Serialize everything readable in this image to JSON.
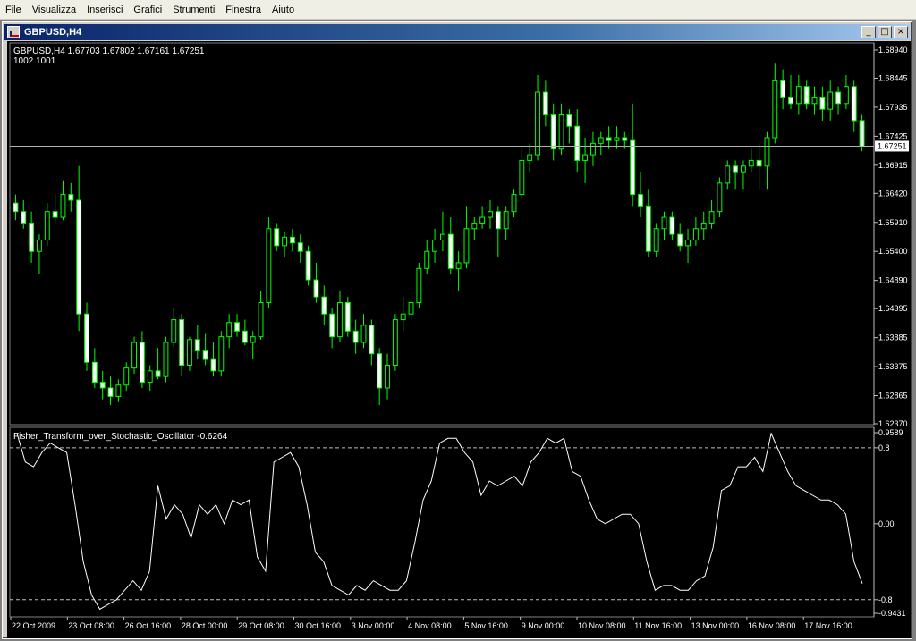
{
  "menu": [
    "File",
    "Visualizza",
    "Inserisci",
    "Grafici",
    "Strumenti",
    "Finestra",
    "Aiuto"
  ],
  "window": {
    "title": "GBPUSD,H4",
    "min_btn": "_",
    "max_btn": "□",
    "close_btn": "×"
  },
  "colors": {
    "background": "#000000",
    "bull": "#ffffff",
    "wick": "#00ff00",
    "indicator": "#ffffff",
    "level": "#c0c0c0"
  },
  "main_chart": {
    "info_line1": "GBPUSD,H4  1.67703 1.67802 1.67161 1.67251",
    "info_line2": "1002  1001",
    "current_price_label": "1.67251",
    "price_ticks": [
      "1.68940",
      "1.68445",
      "1.67935",
      "1.67425",
      "1.66915",
      "1.66420",
      "1.65910",
      "1.65400",
      "1.64890",
      "1.64395",
      "1.63885",
      "1.63375",
      "1.62865",
      "1.62370"
    ]
  },
  "indicator": {
    "label": "Fisher_Transform_over_Stochastic_Oscillator -0.6264",
    "ticks": [
      "0.9589",
      "0.8",
      "0.00",
      "-0.8",
      "-0.9431"
    ]
  },
  "time_axis": [
    "22 Oct 2009",
    "23 Oct 08:00",
    "26 Oct 16:00",
    "28 Oct 00:00",
    "29 Oct 08:00",
    "30 Oct 16:00",
    "3 Nov 00:00",
    "4 Nov 08:00",
    "5 Nov 16:00",
    "9 Nov 00:00",
    "10 Nov 08:00",
    "11 Nov 16:00",
    "13 Nov 00:00",
    "16 Nov 08:00",
    "17 Nov 16:00"
  ],
  "chart_data": {
    "type": "candlestick",
    "symbol": "GBPUSD",
    "timeframe": "H4",
    "ylim": [
      1.6237,
      1.6894
    ],
    "last_price": 1.67251,
    "candles": [
      [
        1.6625,
        1.664,
        1.6595,
        1.661
      ],
      [
        1.661,
        1.663,
        1.658,
        1.659
      ],
      [
        1.659,
        1.661,
        1.652,
        1.654
      ],
      [
        1.654,
        1.657,
        1.65,
        1.656
      ],
      [
        1.656,
        1.6625,
        1.655,
        1.661
      ],
      [
        1.661,
        1.664,
        1.659,
        1.66
      ],
      [
        1.66,
        1.6665,
        1.6595,
        1.664
      ],
      [
        1.664,
        1.666,
        1.661,
        1.663
      ],
      [
        1.663,
        1.669,
        1.64,
        1.643
      ],
      [
        1.643,
        1.645,
        1.633,
        1.6345
      ],
      [
        1.6345,
        1.637,
        1.63,
        1.631
      ],
      [
        1.631,
        1.633,
        1.628,
        1.63
      ],
      [
        1.63,
        1.632,
        1.627,
        1.6285
      ],
      [
        1.6285,
        1.6315,
        1.6275,
        1.6305
      ],
      [
        1.6305,
        1.6345,
        1.6295,
        1.6335
      ],
      [
        1.6335,
        1.639,
        1.6325,
        1.638
      ],
      [
        1.638,
        1.64,
        1.63,
        1.631
      ],
      [
        1.631,
        1.634,
        1.6295,
        1.633
      ],
      [
        1.633,
        1.637,
        1.6315,
        1.632
      ],
      [
        1.632,
        1.639,
        1.631,
        1.638
      ],
      [
        1.638,
        1.644,
        1.637,
        1.642
      ],
      [
        1.642,
        1.643,
        1.632,
        1.634
      ],
      [
        1.634,
        1.639,
        1.633,
        1.6385
      ],
      [
        1.6385,
        1.641,
        1.635,
        1.6365
      ],
      [
        1.6365,
        1.6395,
        1.634,
        1.635
      ],
      [
        1.635,
        1.638,
        1.632,
        1.633
      ],
      [
        1.633,
        1.64,
        1.632,
        1.639
      ],
      [
        1.639,
        1.643,
        1.637,
        1.6415
      ],
      [
        1.6415,
        1.643,
        1.639,
        1.64
      ],
      [
        1.64,
        1.642,
        1.6375,
        1.638
      ],
      [
        1.638,
        1.64,
        1.635,
        1.639
      ],
      [
        1.639,
        1.647,
        1.6385,
        1.645
      ],
      [
        1.645,
        1.66,
        1.644,
        1.658
      ],
      [
        1.658,
        1.659,
        1.654,
        1.655
      ],
      [
        1.655,
        1.6575,
        1.653,
        1.6565
      ],
      [
        1.6565,
        1.658,
        1.654,
        1.6555
      ],
      [
        1.6555,
        1.657,
        1.652,
        1.654
      ],
      [
        1.654,
        1.655,
        1.648,
        1.649
      ],
      [
        1.649,
        1.652,
        1.645,
        1.646
      ],
      [
        1.646,
        1.648,
        1.641,
        1.643
      ],
      [
        1.643,
        1.644,
        1.637,
        1.639
      ],
      [
        1.639,
        1.647,
        1.638,
        1.645
      ],
      [
        1.645,
        1.646,
        1.639,
        1.64
      ],
      [
        1.64,
        1.642,
        1.636,
        1.638
      ],
      [
        1.638,
        1.643,
        1.637,
        1.641
      ],
      [
        1.641,
        1.642,
        1.634,
        1.636
      ],
      [
        1.636,
        1.637,
        1.627,
        1.63
      ],
      [
        1.63,
        1.636,
        1.628,
        1.634
      ],
      [
        1.634,
        1.643,
        1.633,
        1.642
      ],
      [
        1.642,
        1.646,
        1.64,
        1.643
      ],
      [
        1.643,
        1.647,
        1.642,
        1.645
      ],
      [
        1.645,
        1.652,
        1.644,
        1.651
      ],
      [
        1.651,
        1.656,
        1.65,
        1.654
      ],
      [
        1.654,
        1.658,
        1.652,
        1.656
      ],
      [
        1.656,
        1.661,
        1.654,
        1.657
      ],
      [
        1.657,
        1.66,
        1.65,
        1.651
      ],
      [
        1.651,
        1.654,
        1.647,
        1.652
      ],
      [
        1.652,
        1.662,
        1.651,
        1.658
      ],
      [
        1.658,
        1.66,
        1.656,
        1.659
      ],
      [
        1.659,
        1.662,
        1.658,
        1.66
      ],
      [
        1.66,
        1.663,
        1.658,
        1.661
      ],
      [
        1.661,
        1.662,
        1.653,
        1.658
      ],
      [
        1.658,
        1.662,
        1.656,
        1.661
      ],
      [
        1.661,
        1.665,
        1.66,
        1.664
      ],
      [
        1.664,
        1.672,
        1.663,
        1.67
      ],
      [
        1.67,
        1.673,
        1.668,
        1.671
      ],
      [
        1.671,
        1.685,
        1.67,
        1.682
      ],
      [
        1.682,
        1.684,
        1.676,
        1.678
      ],
      [
        1.678,
        1.68,
        1.67,
        1.672
      ],
      [
        1.672,
        1.68,
        1.671,
        1.678
      ],
      [
        1.678,
        1.679,
        1.673,
        1.676
      ],
      [
        1.676,
        1.679,
        1.668,
        1.67
      ],
      [
        1.67,
        1.674,
        1.666,
        1.671
      ],
      [
        1.671,
        1.675,
        1.669,
        1.673
      ],
      [
        1.673,
        1.675,
        1.671,
        1.674
      ],
      [
        1.674,
        1.676,
        1.672,
        1.6735
      ],
      [
        1.6735,
        1.676,
        1.672,
        1.674
      ],
      [
        1.674,
        1.675,
        1.672,
        1.6735
      ],
      [
        1.6735,
        1.68,
        1.662,
        1.664
      ],
      [
        1.664,
        1.668,
        1.66,
        1.662
      ],
      [
        1.662,
        1.665,
        1.653,
        1.654
      ],
      [
        1.654,
        1.659,
        1.653,
        1.658
      ],
      [
        1.658,
        1.661,
        1.656,
        1.66
      ],
      [
        1.66,
        1.661,
        1.656,
        1.657
      ],
      [
        1.657,
        1.659,
        1.654,
        1.655
      ],
      [
        1.655,
        1.658,
        1.652,
        1.656
      ],
      [
        1.656,
        1.66,
        1.655,
        1.658
      ],
      [
        1.658,
        1.661,
        1.656,
        1.659
      ],
      [
        1.659,
        1.663,
        1.658,
        1.661
      ],
      [
        1.661,
        1.667,
        1.66,
        1.666
      ],
      [
        1.666,
        1.67,
        1.665,
        1.669
      ],
      [
        1.669,
        1.67,
        1.665,
        1.668
      ],
      [
        1.668,
        1.67,
        1.665,
        1.669
      ],
      [
        1.669,
        1.672,
        1.668,
        1.67
      ],
      [
        1.67,
        1.673,
        1.665,
        1.669
      ],
      [
        1.669,
        1.675,
        1.665,
        1.674
      ],
      [
        1.674,
        1.687,
        1.673,
        1.684
      ],
      [
        1.684,
        1.686,
        1.679,
        1.681
      ],
      [
        1.681,
        1.685,
        1.679,
        1.68
      ],
      [
        1.68,
        1.685,
        1.678,
        1.683
      ],
      [
        1.683,
        1.684,
        1.679,
        1.68
      ],
      [
        1.68,
        1.683,
        1.678,
        1.681
      ],
      [
        1.681,
        1.683,
        1.677,
        1.679
      ],
      [
        1.679,
        1.684,
        1.677,
        1.682
      ],
      [
        1.682,
        1.683,
        1.678,
        1.68
      ],
      [
        1.68,
        1.685,
        1.679,
        1.683
      ],
      [
        1.683,
        1.684,
        1.675,
        1.677
      ],
      [
        1.677,
        1.678,
        1.6716,
        1.6725
      ]
    ],
    "indicator_series": {
      "name": "Fisher_Transform_over_Stochastic_Oscillator",
      "ylim": [
        -0.9431,
        0.9589
      ],
      "levels": [
        0.8,
        -0.8
      ],
      "values": [
        0.95,
        0.65,
        0.6,
        0.75,
        0.85,
        0.8,
        0.75,
        0.2,
        -0.4,
        -0.75,
        -0.9,
        -0.85,
        -0.8,
        -0.7,
        -0.6,
        -0.7,
        -0.5,
        0.4,
        0.05,
        0.2,
        0.1,
        -0.15,
        0.2,
        0.1,
        0.2,
        0.0,
        0.25,
        0.2,
        0.25,
        -0.35,
        -0.5,
        0.65,
        0.7,
        0.75,
        0.6,
        0.2,
        -0.3,
        -0.4,
        -0.65,
        -0.7,
        -0.75,
        -0.65,
        -0.7,
        -0.6,
        -0.65,
        -0.7,
        -0.7,
        -0.6,
        -0.2,
        0.25,
        0.45,
        0.85,
        0.9,
        0.9,
        0.75,
        0.65,
        0.3,
        0.45,
        0.4,
        0.45,
        0.5,
        0.4,
        0.65,
        0.75,
        0.9,
        0.85,
        0.9,
        0.55,
        0.5,
        0.25,
        0.05,
        0.0,
        0.05,
        0.1,
        0.1,
        0.0,
        -0.4,
        -0.7,
        -0.65,
        -0.65,
        -0.7,
        -0.7,
        -0.6,
        -0.55,
        -0.25,
        0.35,
        0.4,
        0.6,
        0.6,
        0.7,
        0.55,
        0.95,
        0.75,
        0.55,
        0.4,
        0.35,
        0.3,
        0.25,
        0.25,
        0.2,
        0.1,
        -0.4,
        -0.63
      ]
    }
  }
}
